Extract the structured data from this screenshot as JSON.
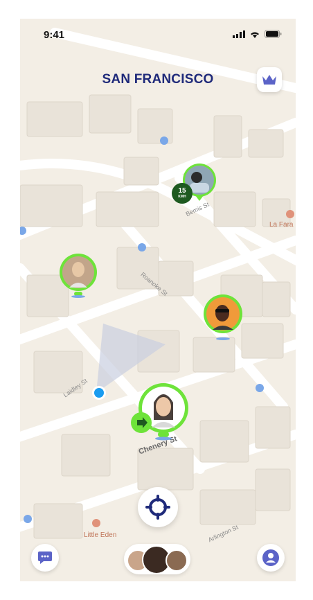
{
  "status_bar": {
    "time": "9:41"
  },
  "header": {
    "city": "SAN FRANCISCO"
  },
  "map": {
    "streets": [
      "Bemis St",
      "Roanoke St",
      "Laidley St",
      "Chenery St",
      "Arlington St"
    ],
    "pois": [
      "La Fara",
      "Little Eden"
    ]
  },
  "friends_on_map": [
    {
      "id": "friend-1",
      "speed": "15",
      "speed_unit": "KMH",
      "ring_color": "#6ee33a"
    },
    {
      "id": "friend-2",
      "ring_color": "#6ee33a"
    },
    {
      "id": "friend-3",
      "ring_color": "#6ee33a"
    },
    {
      "id": "friend-4",
      "ring_color": "#6ee33a",
      "badge": "walking"
    }
  ],
  "colors": {
    "brand": "#1f2a7a",
    "accent": "#5b63c7",
    "ring": "#6ee33a",
    "location_dot": "#1a9cf0"
  },
  "icons": [
    "signal-icon",
    "wifi-icon",
    "battery-icon",
    "crown-icon",
    "crosshair-icon",
    "chat-icon",
    "profile-icon",
    "bus-icon"
  ]
}
